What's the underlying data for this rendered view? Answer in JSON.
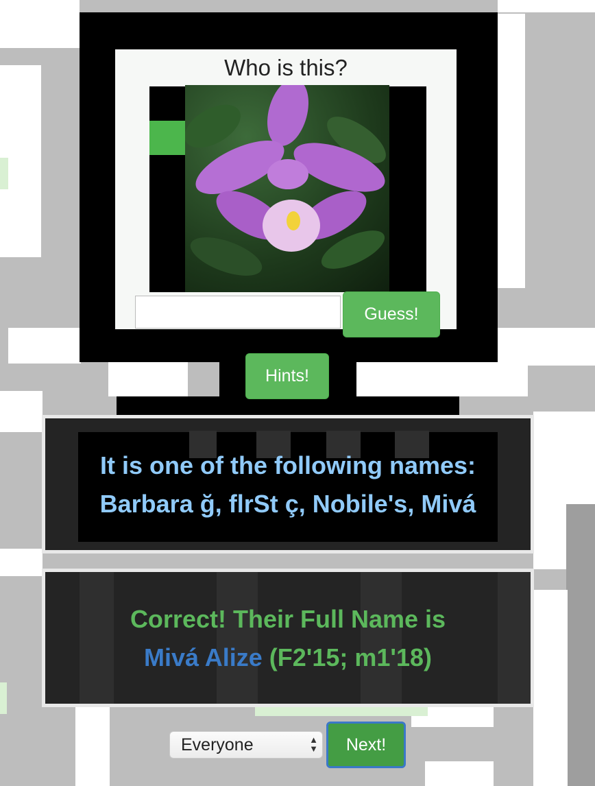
{
  "quiz": {
    "question": "Who is this?",
    "guess_input_value": "",
    "guess_button": "Guess!",
    "hints_button": "Hints!",
    "photo_icon": "orchid-photo"
  },
  "hints": {
    "line1": "It is one of the following names:",
    "line2": "Barbara ğ, flrSt ç, Nobile's, Mivá"
  },
  "answer": {
    "prefix": "Correct! Their Full Name is",
    "name": "Mivá Alize",
    "suffix": "(F2'15; m1'18)"
  },
  "controls": {
    "group_selected": "Everyone",
    "next_button": "Next!"
  },
  "colors": {
    "button_green": "#5cb85c",
    "hint_text": "#90caf9",
    "answer_name": "#3a7bc8"
  }
}
